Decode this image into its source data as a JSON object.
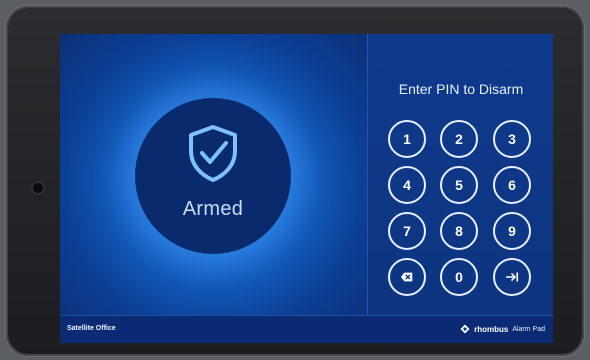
{
  "status": {
    "label": "Armed",
    "icon": "shield-check-icon"
  },
  "pin": {
    "title": "Enter PIN to Disarm"
  },
  "keypad": {
    "keys": [
      {
        "label": "1"
      },
      {
        "label": "2"
      },
      {
        "label": "3"
      },
      {
        "label": "4"
      },
      {
        "label": "5"
      },
      {
        "label": "6"
      },
      {
        "label": "7"
      },
      {
        "label": "8"
      },
      {
        "label": "9"
      },
      {
        "label": "",
        "icon": "backspace-icon"
      },
      {
        "label": "0"
      },
      {
        "label": "",
        "icon": "enter-icon"
      }
    ]
  },
  "footer": {
    "location": "Satellite Office",
    "brand": "rhombus",
    "product": "Alarm Pad"
  },
  "colors": {
    "accent": "#2d8fe6",
    "panel": "#0d3580",
    "text": "#ffffff"
  }
}
